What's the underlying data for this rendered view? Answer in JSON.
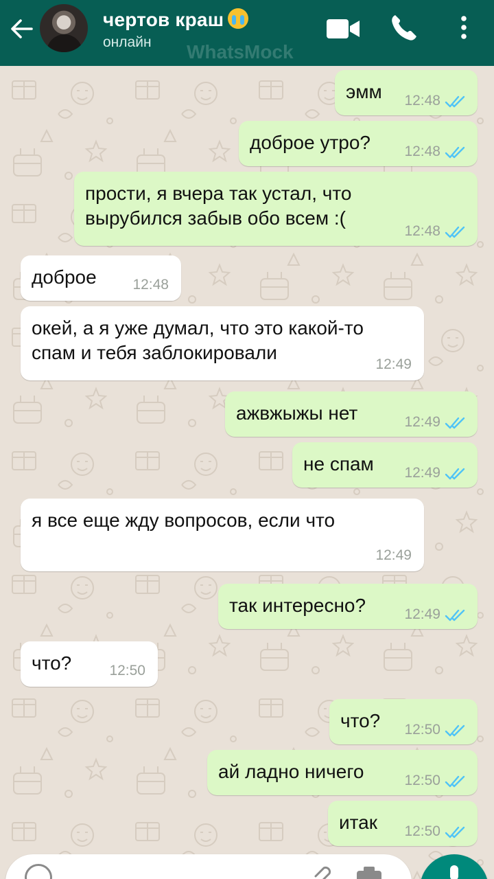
{
  "header": {
    "contact_name": "чертов краш",
    "emoji": "loudly-crying-face",
    "status": "онлайн",
    "watermark": "WhatsMock",
    "icons": [
      "back-arrow-icon",
      "video-call-icon",
      "phone-icon",
      "more-vert-icon"
    ]
  },
  "colors": {
    "header": "#075e54",
    "outgoing_bubble": "#dcf8c6",
    "incoming_bubble": "#ffffff",
    "read_ticks": "#4fc3f7",
    "wallpaper": "#e9e1d8",
    "mic_button": "#00897b"
  },
  "messages": [
    {
      "direction": "out",
      "text": "эмм",
      "time": "12:48",
      "status": "read"
    },
    {
      "direction": "out",
      "text": "доброе утро?",
      "time": "12:48",
      "status": "read"
    },
    {
      "direction": "out",
      "text": "прости, я вчера так устал, что\nвырубился забыв обо всем :(",
      "time": "12:48",
      "status": "read"
    },
    {
      "direction": "in",
      "text": "доброе",
      "time": "12:48"
    },
    {
      "direction": "in",
      "text": "окей, а я уже думал, что это какой-то\nспам и тебя заблокировали",
      "time": "12:49"
    },
    {
      "direction": "out",
      "text": "ажвжыжы нет",
      "time": "12:49",
      "status": "read"
    },
    {
      "direction": "out",
      "text": "не спам",
      "time": "12:49",
      "status": "read"
    },
    {
      "direction": "in",
      "text": "я все еще жду вопросов, если что",
      "time": "12:49"
    },
    {
      "direction": "out",
      "text": "так интересно?",
      "time": "12:49",
      "status": "read"
    },
    {
      "direction": "in",
      "text": "что?",
      "time": "12:50"
    },
    {
      "direction": "out",
      "text": "что?",
      "time": "12:50",
      "status": "read"
    },
    {
      "direction": "out",
      "text": "ай ладно ничего",
      "time": "12:50",
      "status": "read"
    },
    {
      "direction": "out",
      "text": "итак",
      "time": "12:50",
      "status": "read"
    }
  ],
  "composer": {
    "icons": [
      "emoji-icon",
      "attach-icon",
      "camera-icon",
      "mic-icon"
    ]
  }
}
